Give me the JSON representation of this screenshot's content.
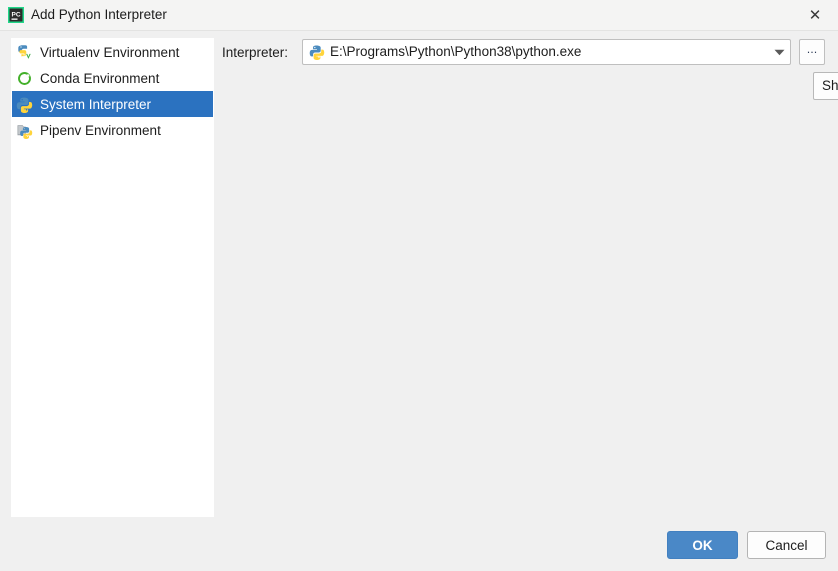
{
  "window": {
    "title": "Add Python Interpreter",
    "app_icon": "pycharm-icon",
    "close_label": "✕"
  },
  "sidebar": {
    "items": [
      {
        "label": "Virtualenv Environment",
        "icon": "virtualenv-icon",
        "selected": false
      },
      {
        "label": "Conda Environment",
        "icon": "conda-icon",
        "selected": false
      },
      {
        "label": "System Interpreter",
        "icon": "python-icon",
        "selected": true
      },
      {
        "label": "Pipenv Environment",
        "icon": "pipenv-icon",
        "selected": false
      }
    ]
  },
  "main": {
    "interpreter_label": "Interpreter:",
    "interpreter_value": "E:\\Programs\\Python\\Python38\\python.exe",
    "interpreter_icon": "python-icon",
    "dropdown_icon": "chevron-down-icon",
    "browse_button_label": "...",
    "aux_button_label": "Sh"
  },
  "footer": {
    "ok_label": "OK",
    "cancel_label": "Cancel"
  },
  "colors": {
    "accent_button": "#4a88c7",
    "selection": "#2b72c0",
    "dialog_background": "#f0f0f0",
    "titlebar_background": "#f4f4f3",
    "list_background": "#ffffff",
    "text": "#1c1c1c"
  }
}
